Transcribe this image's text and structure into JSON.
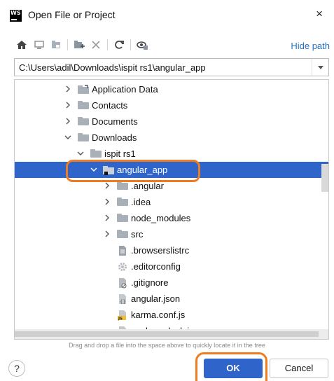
{
  "window": {
    "app_icon": "WS",
    "title": "Open File or Project",
    "close_glyph": "×"
  },
  "toolbar": {
    "buttons": [
      "home-icon",
      "desktop-icon",
      "project-icon",
      "new-folder-icon",
      "delete-icon",
      "refresh-icon",
      "show-hidden-icon"
    ],
    "hide_path_label": "Hide path"
  },
  "path": {
    "value": "C:\\Users\\adil\\Downloads\\ispit rs1\\angular_app"
  },
  "tree": {
    "items": [
      {
        "label": "Application Data",
        "icon": "folder-shortcut-icon",
        "expander": "collapsed"
      },
      {
        "label": "Contacts",
        "icon": "folder-icon",
        "expander": "collapsed"
      },
      {
        "label": "Documents",
        "icon": "folder-icon",
        "expander": "collapsed"
      },
      {
        "label": "Downloads",
        "icon": "folder-icon",
        "expander": "expanded"
      },
      {
        "label": "ispit rs1",
        "icon": "folder-icon",
        "expander": "expanded"
      },
      {
        "label": "angular_app",
        "icon": "project-folder-icon",
        "expander": "expanded",
        "selected": true
      },
      {
        "label": ".angular",
        "icon": "folder-icon",
        "expander": "collapsed"
      },
      {
        "label": ".idea",
        "icon": "folder-icon",
        "expander": "collapsed"
      },
      {
        "label": "node_modules",
        "icon": "folder-icon",
        "expander": "collapsed"
      },
      {
        "label": "src",
        "icon": "folder-icon",
        "expander": "collapsed"
      },
      {
        "label": ".browserslistrc",
        "icon": "text-file-icon",
        "expander": "none"
      },
      {
        "label": ".editorconfig",
        "icon": "gear-file-icon",
        "expander": "none"
      },
      {
        "label": ".gitignore",
        "icon": "ignore-file-icon",
        "expander": "none"
      },
      {
        "label": "angular.json",
        "icon": "json-file-icon",
        "expander": "none"
      },
      {
        "label": "karma.conf.js",
        "icon": "js-file-icon",
        "expander": "none"
      },
      {
        "label": "package-lock.json",
        "icon": "json-file-icon",
        "expander": "none"
      }
    ]
  },
  "hint": "Drag and drop a file into the space above to quickly locate it in the tree",
  "footer": {
    "help_label": "?",
    "ok_label": "OK",
    "cancel_label": "Cancel"
  },
  "colors": {
    "selection": "#2f65ca",
    "link": "#2670c2",
    "annotation": "#f07c22"
  }
}
